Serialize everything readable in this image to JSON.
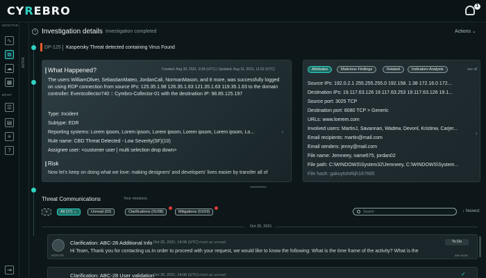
{
  "app": {
    "logo": "CYREBRO",
    "notifications_count": "1"
  },
  "sidebar": {
    "monitor_label": "MONITOR",
    "brief_label": "BRIEF",
    "items": [
      {
        "icon": "activity-icon",
        "glyph": "∿"
      },
      {
        "icon": "investigations-icon",
        "glyph": "⧉"
      },
      {
        "icon": "cloud-icon",
        "glyph": "☁"
      },
      {
        "icon": "grid-icon",
        "glyph": "▦"
      },
      {
        "icon": "user-list-icon",
        "glyph": "☰"
      },
      {
        "icon": "report-icon",
        "glyph": "▤"
      },
      {
        "icon": "tasks-icon",
        "glyph": "≡"
      },
      {
        "icon": "help-icon",
        "glyph": "?"
      },
      {
        "icon": "logout-icon",
        "glyph": "⇥"
      }
    ]
  },
  "rail": {
    "label": "MITRE"
  },
  "header": {
    "title": "Investigation details",
    "subtitle": "Investigation completed",
    "actions_label": "Actions ⌄",
    "case_id": "DP-125",
    "case_name": "Kaspersky Threat detected containing Virus Found"
  },
  "what_happened": {
    "title": "What Happened?",
    "meta": "Created: Aug 30, 2021, 9:34 (UTC)  |  Updated: Aug 31, 2021, 11:52 (UTC)",
    "description": "The users WilliamOliver, SebastianMateo, JordanCali, NormanMason, and 8 more, was successfully logged on using RDP connection from source IPs: 125.35.1.98  126.35.1.63  121.35.1.63  119.35.1.63 to the domain controller: Eventcollector740 :: Cyrebro-Collector-01 with the destination IP: 98.85.125.197",
    "fields": [
      {
        "key": "Type:",
        "value": "Incident"
      },
      {
        "key": "Subtype:",
        "value": "EDR"
      },
      {
        "key": "Reporting systems:",
        "value": "Lorem ipsom,  Lorem ipsom,  Lorem ipsom,  Lorem ipsom,  Lorem ipsom,  Lo..."
      },
      {
        "key": "Rule name:",
        "value": "CBD Threat Detected -  Low Severity(SF)(10)"
      },
      {
        "key": "Assignee user:",
        "value": "<customer user | multi selection drop down>"
      }
    ],
    "risk_title": "Risk",
    "risk_text": "Now let's keep on doing what we love: making designers' and developers' lives easier by transfer all of"
  },
  "attributes": {
    "tabs": [
      "Attributes",
      "Malicious Findings",
      "Related",
      "Indicators Analysis"
    ],
    "see_all": "see all",
    "rows": [
      "Source IPs: 192.0.2.1   255.255.255.0   192.158. 1.38   172.16.0   172...",
      "Destination IPs: 19.117.63.126   19.117.63.253   19.117.63.126   19.1...",
      "Source port: 3025 TCP",
      "Destination port: 8080 TCP > Generic",
      "URLs: www.loerem.com",
      "Involved users: MartinJ,  Savannan,  Wadew,  Devonl,  Kristinw,  Carjer...",
      "Email recipients: martin@mail.com",
      "Email senders: jenny@mail.com",
      "File name: Jemneey, name675, jordan02",
      "File path: C:\\WINDOWS\\System32\\Jemneey, C:\\WINDOWS\\System...",
      "File hash: gakuytsh#kjh187665"
    ]
  },
  "communications": {
    "title": "Threat Communications",
    "missions_label": "Your missions",
    "add_label": "+",
    "all_label": "All (17) ⌄",
    "unread_label": "Unread (02)",
    "clarifications_label": "Clarifications (01/08)",
    "mitigations_label": "Mitigations (01/03)",
    "search_placeholder": "Search",
    "sort_label": "↓ Newest",
    "date_divider": "Oct 25, 2021",
    "messages": [
      {
        "title": "Clarification: ABC-28 Additional Info",
        "date": "Oct 25, 2021, 14:06 (UTC)",
        "unread": "mark as unread",
        "body": "Hi Team, Thank you for contacting us.In order to proceed with your request, we would like to know the following: What is the time frame of the activity? What is the",
        "status": "To Do",
        "see_more": "see more",
        "avatar_label": "MONITR"
      },
      {
        "title": "Clarification: ABC-28  User validation",
        "date": "Oct 25, 2021, 14:00 (UTC)",
        "unread": "mark as unread"
      }
    ]
  }
}
